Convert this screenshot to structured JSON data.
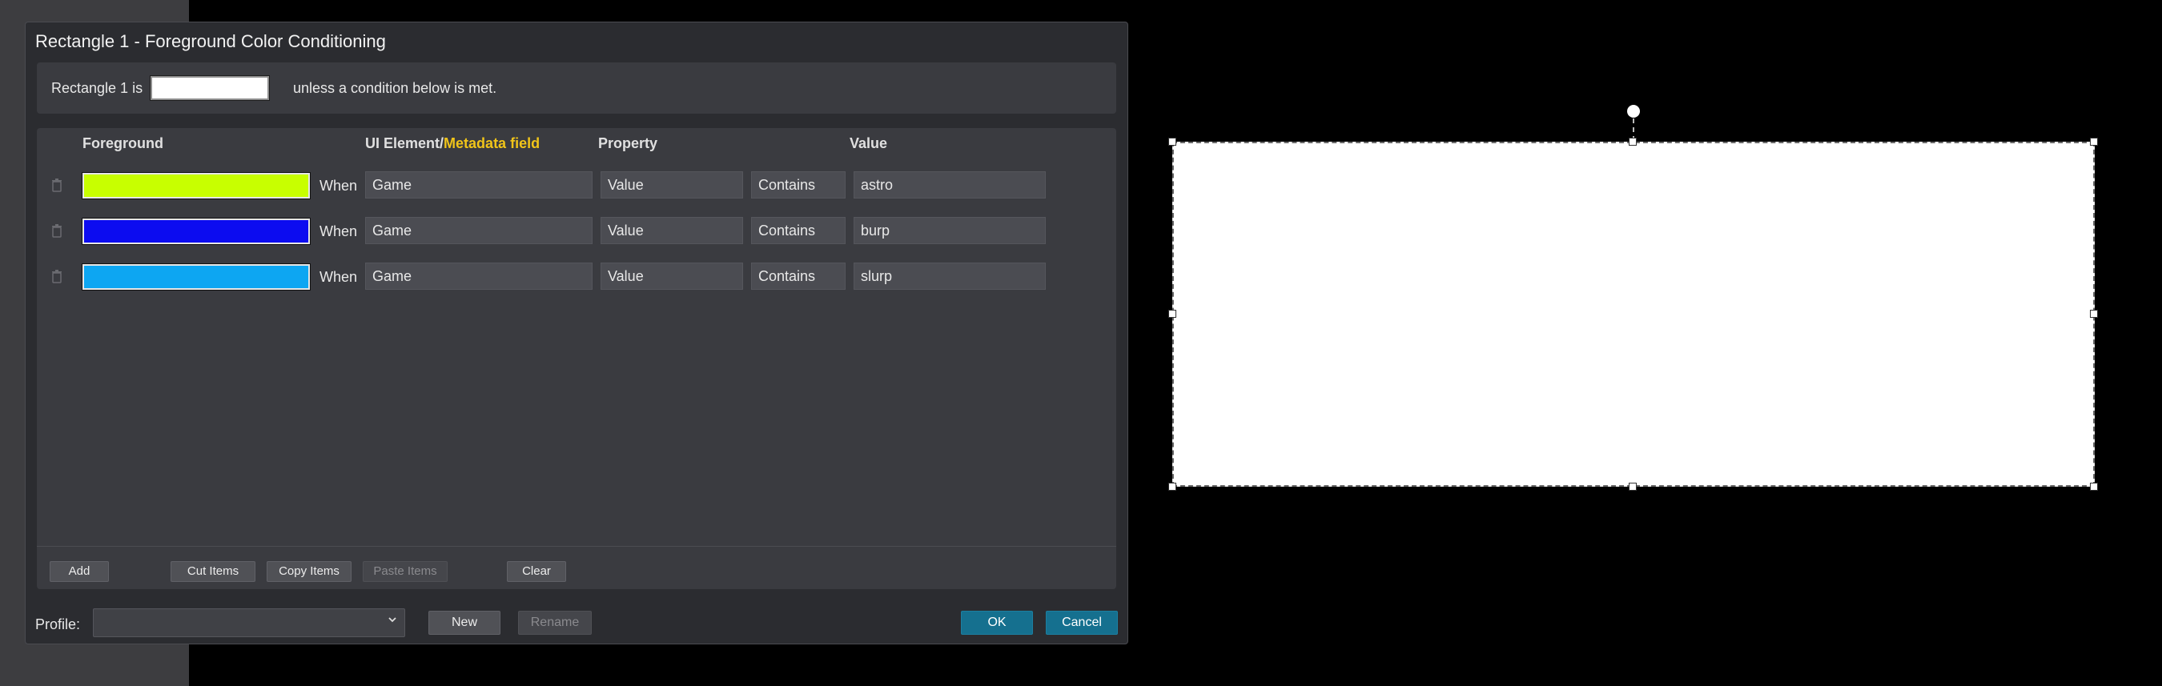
{
  "dialog": {
    "title": "Rectangle 1 - Foreground Color Conditioning",
    "default_prefix": "Rectangle 1 is",
    "default_color": "#ffffff",
    "default_suffix": "unless a condition below is met."
  },
  "columns": {
    "foreground": "Foreground",
    "ui_element": "UI Element",
    "separator": "/",
    "metadata_field": "Metadata field",
    "property": "Property",
    "value": "Value"
  },
  "conditions": [
    {
      "color": "#c8ff00",
      "when": "When",
      "element": "Game",
      "property": "Value",
      "operator": "Contains",
      "value": "astro"
    },
    {
      "color": "#0c0cf0",
      "when": "When",
      "element": "Game",
      "property": "Value",
      "operator": "Contains",
      "value": "burp"
    },
    {
      "color": "#0da6f2",
      "when": "When",
      "element": "Game",
      "property": "Value",
      "operator": "Contains",
      "value": "slurp"
    }
  ],
  "buttons": {
    "add": "Add",
    "cut": "Cut Items",
    "copy": "Copy Items",
    "paste": "Paste Items",
    "clear": "Clear",
    "new": "New",
    "rename": "Rename",
    "ok": "OK",
    "cancel": "Cancel"
  },
  "profile": {
    "label": "Profile:",
    "value": ""
  },
  "colors": {
    "accent": "#15708f",
    "metadata_highlight": "#f0c419"
  }
}
